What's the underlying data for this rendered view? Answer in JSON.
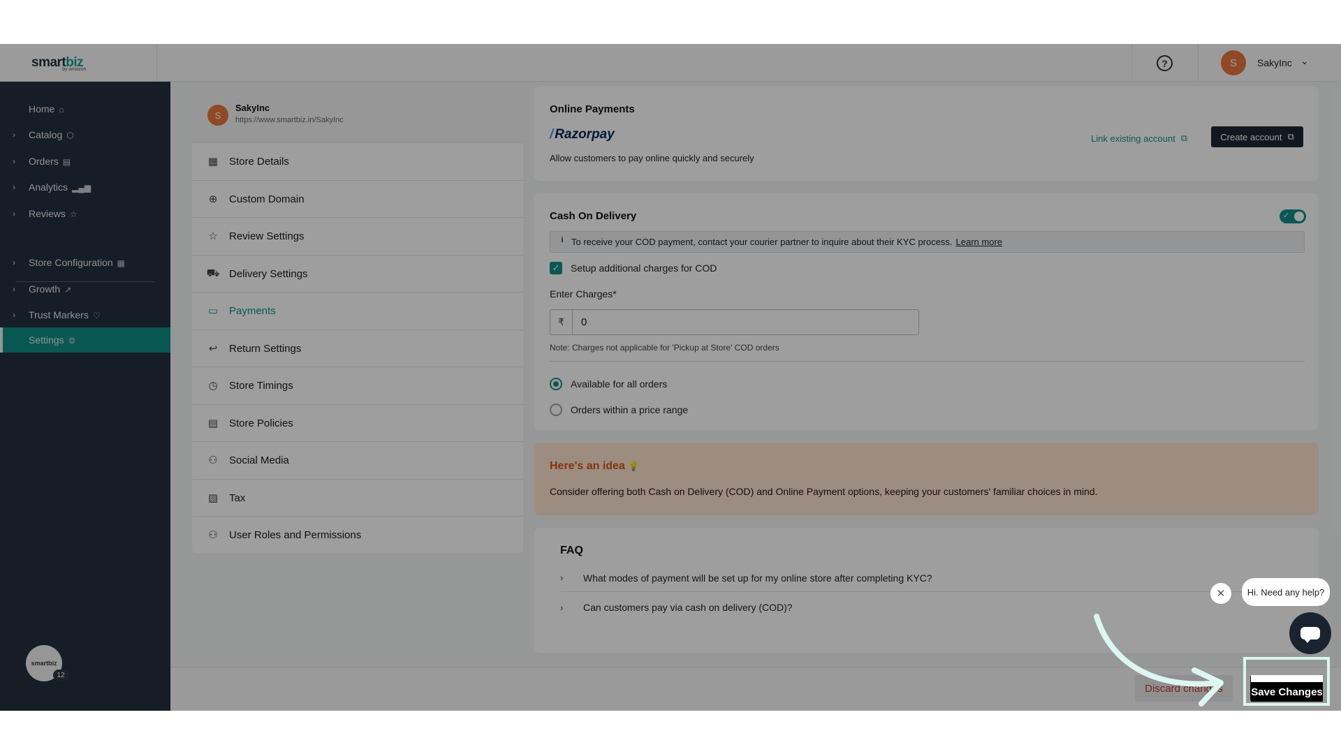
{
  "topbar": {
    "logo_main": "smart",
    "logo_accent": "biz",
    "logo_sub": "by amazon",
    "help_icon": "?",
    "user_initial": "S",
    "user_name": "SakyInc"
  },
  "sidebar": {
    "items": [
      {
        "label": "Home",
        "icon": "home-icon",
        "glyph": "⌂"
      },
      {
        "label": "Catalog",
        "icon": "box-icon",
        "glyph": "⬡"
      },
      {
        "label": "Orders",
        "icon": "clipboard-icon",
        "glyph": "▤"
      },
      {
        "label": "Analytics",
        "icon": "bar-chart-icon",
        "glyph": "▂▄▆"
      },
      {
        "label": "Reviews",
        "icon": "star-icon",
        "glyph": "☆"
      },
      {
        "label": "Store Configuration",
        "icon": "store-icon",
        "glyph": "▦"
      },
      {
        "label": "Growth",
        "icon": "trend-up-icon",
        "glyph": "↗"
      },
      {
        "label": "Trust Markers",
        "icon": "heart-badge-icon",
        "glyph": "♡"
      },
      {
        "label": "Settings",
        "icon": "gear-icon",
        "glyph": "⚙"
      }
    ],
    "notification_count": "12",
    "bottom_logo": "smartbiz"
  },
  "store": {
    "initial": "S",
    "name": "SakyInc",
    "url": "https://www.smartbiz.in/SakyInc"
  },
  "settings_menu": [
    {
      "label": "Store Details",
      "glyph": "▦"
    },
    {
      "label": "Custom Domain",
      "glyph": "⊕"
    },
    {
      "label": "Review Settings",
      "glyph": "☆"
    },
    {
      "label": "Delivery Settings",
      "glyph": "⛟"
    },
    {
      "label": "Payments",
      "glyph": "▭"
    },
    {
      "label": "Return Settings",
      "glyph": "↩"
    },
    {
      "label": "Store Timings",
      "glyph": "◷"
    },
    {
      "label": "Store Policies",
      "glyph": "▤"
    },
    {
      "label": "Social Media",
      "glyph": "⚇"
    },
    {
      "label": "Tax",
      "glyph": "▧"
    },
    {
      "label": "User Roles and Permissions",
      "glyph": "⚇"
    }
  ],
  "online_payments": {
    "title": "Online Payments",
    "provider": "Razorpay",
    "description": "Allow customers to pay online quickly and securely",
    "link_label": "Link existing account",
    "create_label": "Create account"
  },
  "cod": {
    "title": "Cash On Delivery",
    "enabled": true,
    "info_text": "To receive your COD payment, contact your courier partner to inquire about their KYC process.",
    "learn_more": "Learn more",
    "checkbox_label": "Setup additional charges for COD",
    "charges_label": "Enter Charges*",
    "currency": "₹",
    "charges_value": "0",
    "note": "Note: Charges not applicable for 'Pickup at Store' COD orders",
    "options": [
      {
        "label": "Available for all orders",
        "selected": true
      },
      {
        "label": "Orders within a price range",
        "selected": false
      }
    ]
  },
  "idea": {
    "title": "Here's an idea",
    "bulb": "💡",
    "text": "Consider offering both Cash on Delivery (COD) and Online Payment options, keeping your customers' familiar choices in mind."
  },
  "faq": {
    "title": "FAQ",
    "items": [
      "What modes of payment will be set up for my online store after completing KYC?",
      "Can customers pay via cash on delivery (COD)?"
    ]
  },
  "chat": {
    "greeting": "Hi. Need any help?"
  },
  "footer": {
    "discard_label": "Discard changes",
    "save_label": "Save Changes"
  },
  "colors": {
    "accent": "#0f8f86",
    "sidebar_bg": "#232f3e",
    "idea_bg": "#fde3cf",
    "idea_title": "#d3561c"
  }
}
